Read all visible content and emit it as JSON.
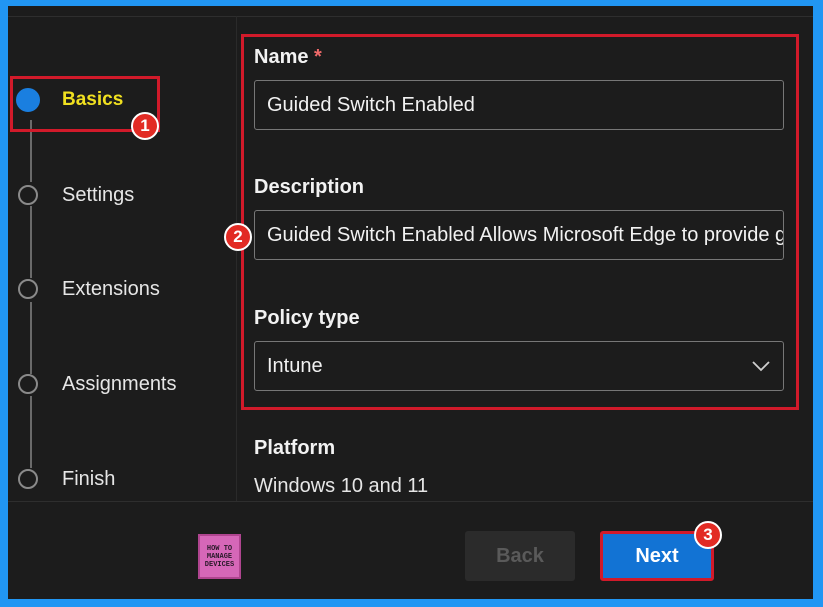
{
  "steps": [
    {
      "label": "Basics",
      "active": true
    },
    {
      "label": "Settings",
      "active": false
    },
    {
      "label": "Extensions",
      "active": false
    },
    {
      "label": "Assignments",
      "active": false
    },
    {
      "label": "Finish",
      "active": false
    }
  ],
  "form": {
    "name_label": "Name",
    "required_marker": "*",
    "name_value": "Guided Switch Enabled",
    "description_label": "Description",
    "description_value": "Guided Switch Enabled Allows Microsoft Edge to provide guided switching between profiles",
    "policy_type_label": "Policy type",
    "policy_type_value": "Intune",
    "platform_label": "Platform",
    "platform_value": "Windows 10 and 11"
  },
  "buttons": {
    "back": "Back",
    "next": "Next"
  },
  "annotations": [
    "1",
    "2",
    "3"
  ],
  "logo": {
    "line1": "HOW TO",
    "line2": "MANAGE",
    "line3": "DEVICES"
  },
  "colors": {
    "accent": "#1273d4",
    "highlight_border": "#d11a2a",
    "active_step_text": "#f0e020",
    "badge": "#e22b24"
  }
}
